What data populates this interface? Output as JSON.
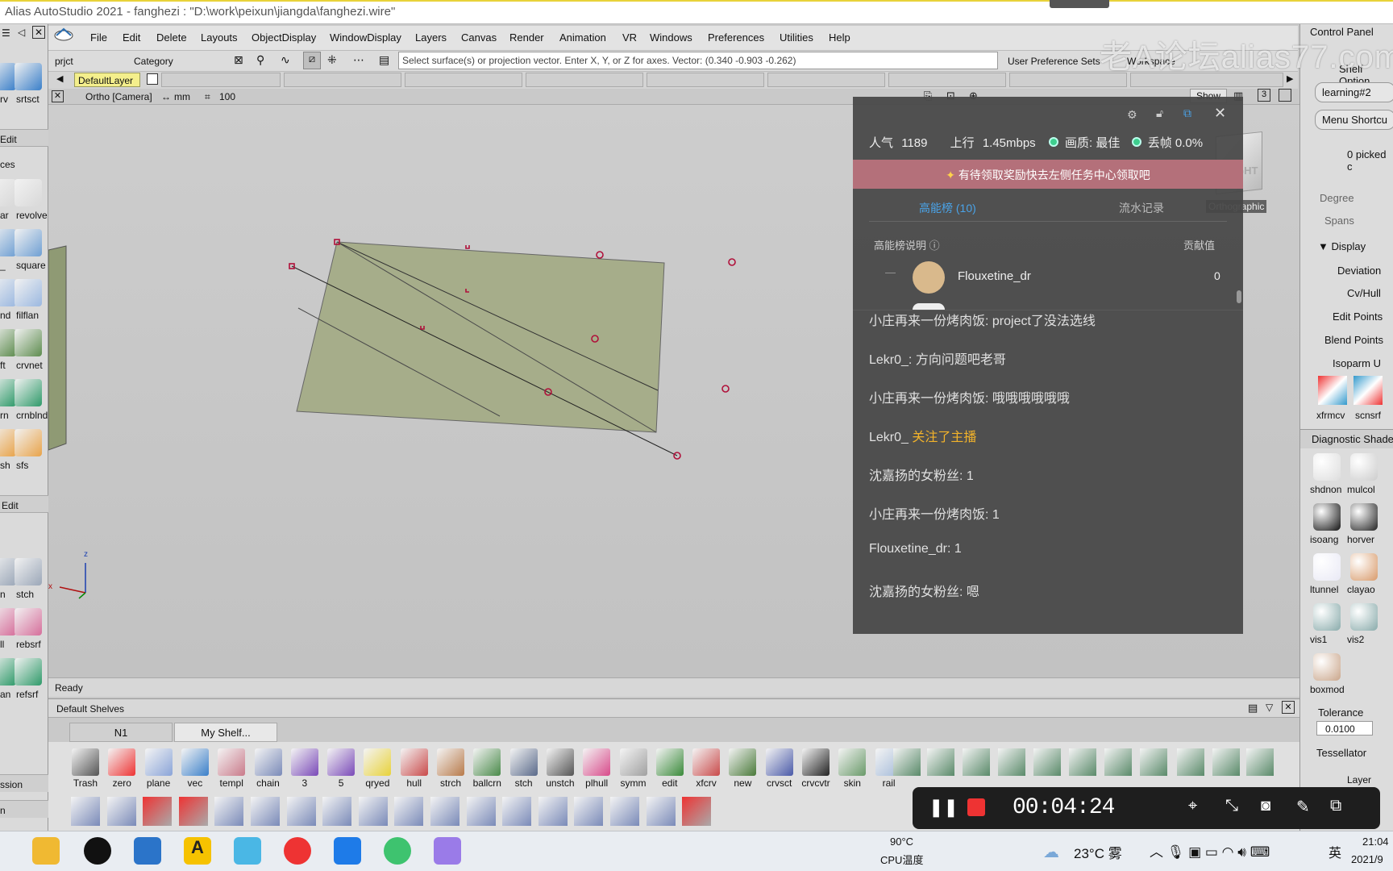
{
  "window": {
    "title": "Alias AutoStudio 2021     - fanghezi : \"D:\\work\\peixun\\jiangda\\fanghezi.wire\""
  },
  "watermark": "老A论坛alias77.com",
  "menu": [
    "File",
    "Edit",
    "Delete",
    "Layouts",
    "ObjectDisplay",
    "WindowDisplay",
    "Layers",
    "Canvas",
    "Render",
    "Animation",
    "VR",
    "Windows",
    "Preferences",
    "Utilities",
    "Help"
  ],
  "toolbar": {
    "prjct_label": "prjct",
    "category_label": "Category",
    "command_text": "Select surface(s) or projection vector.  Enter X, Y, or Z for axes.  Vector: (0.340 -0.903 -0.262)",
    "user_pref": "User Preference Sets",
    "workspace": "Workspace"
  },
  "layers": {
    "default": "DefaultLayer"
  },
  "viewport": {
    "camera": "Ortho [Camera]",
    "units": "mm",
    "grid": "100",
    "show": "Show",
    "view_count": "3",
    "viewcube_face": "RIGHT",
    "viewcube_label": "Orthographic",
    "axis": {
      "z": "z",
      "x": "x"
    }
  },
  "status": {
    "text": "Ready"
  },
  "left_palette": {
    "edit1": "Edit",
    "section1": "ces",
    "edit2": "Edit",
    "section_bottom1": "ssion",
    "section_bottom2": "n",
    "tools": [
      {
        "name": "rv",
        "label": "rv"
      },
      {
        "name": "srtsct",
        "label": "srtsct"
      },
      {
        "name": "ar",
        "label": "ar"
      },
      {
        "name": "revolve",
        "label": "revolve"
      },
      {
        "name": "_",
        "label": "_"
      },
      {
        "name": "square",
        "label": "square"
      },
      {
        "name": "nd",
        "label": "nd"
      },
      {
        "name": "filflan",
        "label": "filflan"
      },
      {
        "name": "ft",
        "label": "ft"
      },
      {
        "name": "crvnet",
        "label": "crvnet"
      },
      {
        "name": "rn",
        "label": "rn"
      },
      {
        "name": "crnblnd",
        "label": "crnblnd"
      },
      {
        "name": "sh",
        "label": "sh"
      },
      {
        "name": "sfs",
        "label": "sfs"
      },
      {
        "name": "n",
        "label": "n"
      },
      {
        "name": "stch",
        "label": "stch"
      },
      {
        "name": "ll",
        "label": "ll"
      },
      {
        "name": "rebsrf",
        "label": "rebsrf"
      },
      {
        "name": "an",
        "label": "an"
      },
      {
        "name": "refsrf",
        "label": "refsrf"
      }
    ]
  },
  "shelf": {
    "title": "Default Shelves",
    "tabs": [
      "N1",
      "My Shelf..."
    ],
    "tools": [
      "Trash",
      "zero",
      "plane",
      "vec",
      "templ",
      "chain",
      "3",
      "5",
      "qryed",
      "hull",
      "strch",
      "ballcrn",
      "stch",
      "unstch",
      "plhull",
      "symm",
      "edit",
      "xfcrv",
      "new",
      "crvsct",
      "crvcvtr",
      "skin",
      "rail"
    ]
  },
  "right_panel": {
    "control_panel": "Control Panel",
    "shelf_options": "Shelf Option",
    "learning": "learning#2",
    "menu_shortcuts": "Menu Shortcu",
    "picked": "0 picked c",
    "degree": "Degree",
    "spans": "Spans",
    "display": "Display",
    "deviation": "Deviation",
    "cvhull": "Cv/Hull",
    "edit_points": "Edit Points",
    "blend_points": "Blend Points",
    "isoparm": "Isoparm U",
    "xfrmcv": "xfrmcv",
    "scnsrf": "scnsrf",
    "diagnostic": "Diagnostic Shade",
    "shaders": [
      {
        "name": "shdnon",
        "label": "shdnon"
      },
      {
        "name": "mulcol",
        "label": "mulcol"
      },
      {
        "name": "isoang",
        "label": "isoang"
      },
      {
        "name": "horver",
        "label": "horver"
      },
      {
        "name": "ltunnel",
        "label": "ltunnel"
      },
      {
        "name": "clayao",
        "label": "clayao"
      },
      {
        "name": "vis1",
        "label": "vis1"
      },
      {
        "name": "vis2",
        "label": "vis2"
      },
      {
        "name": "boxmod",
        "label": "boxmod"
      }
    ],
    "tolerance": "Tolerance",
    "tolerance_value": "0.0100",
    "tessellator": "Tessellator",
    "layer": "Layer"
  },
  "live_panel": {
    "popularity_label": "人气",
    "popularity": "1189",
    "upload_label": "上行",
    "upload": "1.45mbps",
    "quality": "画质: 最佳",
    "drop": "丢帧 0.0%",
    "banner": "有待领取奖励快去左侧任务中心领取吧",
    "tab_rank": "高能榜 (10)",
    "tab_flow": "流水记录",
    "rank_desc": "高能榜说明",
    "contribution": "贡献值",
    "rank_user": "Flouxetine_dr",
    "rank_dash": "—",
    "rank_value": "0",
    "chat": [
      {
        "user": "小庄再来一份烤肉饭",
        "text": ": project了没法选线"
      },
      {
        "user": "Lekr0_",
        "text": ": 方向问题吧老哥"
      },
      {
        "user": "小庄再来一份烤肉饭",
        "text": ": 哦哦哦哦哦哦"
      },
      {
        "user": "Lekr0_",
        "text": " 关注了主播",
        "highlight": true
      },
      {
        "user": "沈嘉扬的女粉丝",
        "text": ": 1"
      },
      {
        "user": "小庄再来一份烤肉饭",
        "text": ": 1"
      },
      {
        "user": "Flouxetine_dr",
        "text": ": 1"
      },
      {
        "user": "沈嘉扬的女粉丝",
        "text": ": 嗯"
      }
    ]
  },
  "recorder": {
    "time": "00:04:24"
  },
  "taskbar": {
    "cpu_temp": "90°C",
    "cpu_label": "CPU温度",
    "weather": "23°C 雾",
    "ime": "英",
    "time": "21:04",
    "date": "2021/9"
  },
  "colors": {
    "accent_live": "#ff4a5c",
    "surface": "#a6ad8a",
    "cv": "#b0103a",
    "layer_yellow": "#f4ef8c"
  }
}
